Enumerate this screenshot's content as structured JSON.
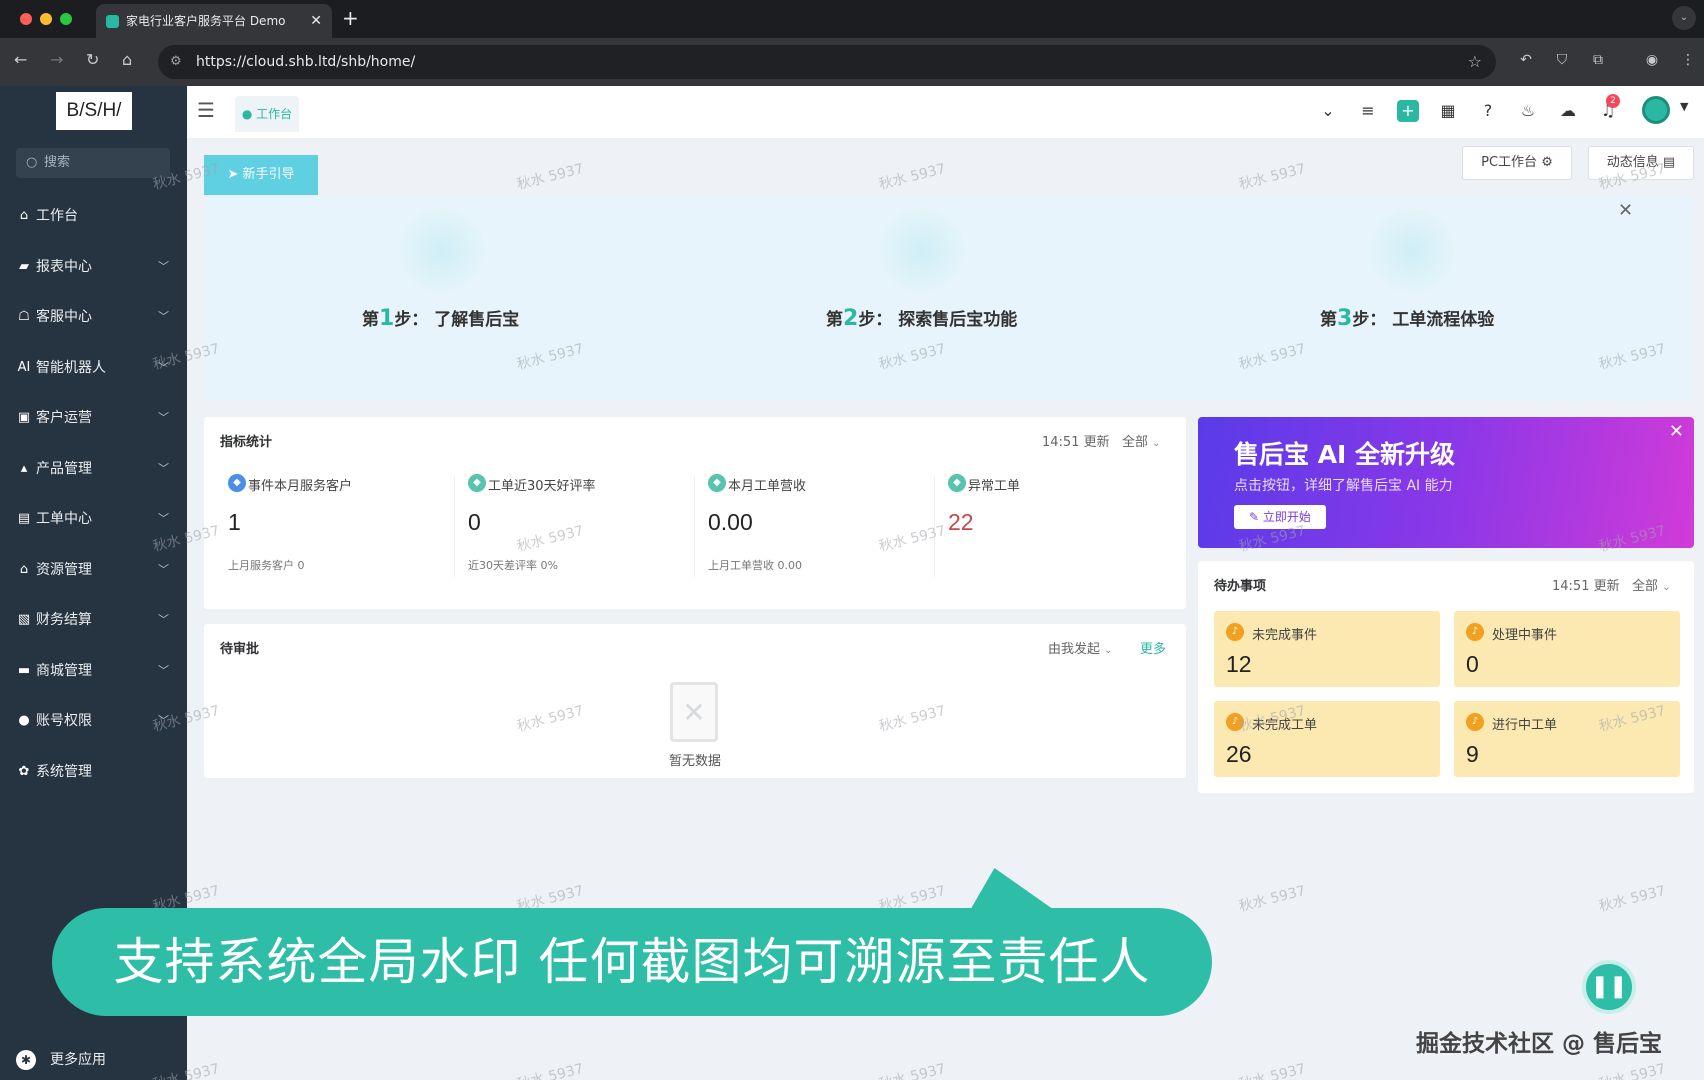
{
  "browser": {
    "tab_title": "家电行业客户服务平台 Demo",
    "url": "https://cloud.shb.ltd/shb/home/"
  },
  "sidebar": {
    "logo": "B/S/H/",
    "search_placeholder": "搜索",
    "items": [
      {
        "label": "工作台",
        "icon": "home-icon",
        "expandable": false
      },
      {
        "label": "报表中心",
        "icon": "chart-icon",
        "expandable": true
      },
      {
        "label": "客服中心",
        "icon": "headset-icon",
        "expandable": true
      },
      {
        "label": "智能机器人",
        "icon": "ai-icon",
        "expandable": true
      },
      {
        "label": "客户运营",
        "icon": "customer-icon",
        "expandable": true
      },
      {
        "label": "产品管理",
        "icon": "product-icon",
        "expandable": true
      },
      {
        "label": "工单中心",
        "icon": "ticket-icon",
        "expandable": true
      },
      {
        "label": "资源管理",
        "icon": "resource-icon",
        "expandable": true
      },
      {
        "label": "财务结算",
        "icon": "finance-icon",
        "expandable": true
      },
      {
        "label": "商城管理",
        "icon": "shop-icon",
        "expandable": true
      },
      {
        "label": "账号权限",
        "icon": "lock-icon",
        "expandable": true
      },
      {
        "label": "系统管理",
        "icon": "gear-icon",
        "expandable": false
      }
    ],
    "more_apps": "更多应用"
  },
  "header": {
    "tab_label": "工作台",
    "notification_count": "2"
  },
  "guide": {
    "button_label": "新手引导",
    "pc_workbench": "PC工作台",
    "dynamic_info": "动态信息",
    "steps": [
      {
        "prefix": "第",
        "num": "1",
        "suffix": "步：",
        "text": "了解售后宝"
      },
      {
        "prefix": "第",
        "num": "2",
        "suffix": "步：",
        "text": "探索售后宝功能"
      },
      {
        "prefix": "第",
        "num": "3",
        "suffix": "步：",
        "text": "工单流程体验"
      }
    ]
  },
  "metrics": {
    "title": "指标统计",
    "updated": "14:51 更新",
    "filter": "全部",
    "items": [
      {
        "label": "事件本月服务客户",
        "value": "1",
        "sub": "上月服务客户  0",
        "color": "#4a8ee8"
      },
      {
        "label": "工单近30天好评率",
        "value": "0",
        "sub": "近30天差评率  0%",
        "color": "#59c4ac"
      },
      {
        "label": "本月工单营收",
        "value": "0.00",
        "sub": "上月工单营收  0.00",
        "color": "#59c4ac"
      },
      {
        "label": "异常工单",
        "value": "22",
        "sub": "",
        "color": "#59c4ac"
      }
    ]
  },
  "approval": {
    "title": "待审批",
    "filter": "由我发起",
    "more": "更多",
    "empty_text": "暂无数据"
  },
  "ai_banner": {
    "title": "售后宝 AI 全新升级",
    "subtitle": "点击按钮，详细了解售后宝 AI 能力",
    "button": "立即开始"
  },
  "todo": {
    "title": "待办事项",
    "updated": "14:51 更新",
    "filter": "全部",
    "items": [
      {
        "label": "未完成事件",
        "value": "12"
      },
      {
        "label": "处理中事件",
        "value": "0"
      },
      {
        "label": "未完成工单",
        "value": "26"
      },
      {
        "label": "进行中工单",
        "value": "9"
      }
    ]
  },
  "watermark": "秋水 5937",
  "caption": "支持系统全局水印 任何截图均可溯源至责任人",
  "credit": "掘金技术社区 @ 售后宝",
  "colors": {
    "accent": "#2bb8a3",
    "sidebar_bg": "#263441",
    "todo_bg": "#fbe9b1",
    "alert": "#c74848"
  }
}
